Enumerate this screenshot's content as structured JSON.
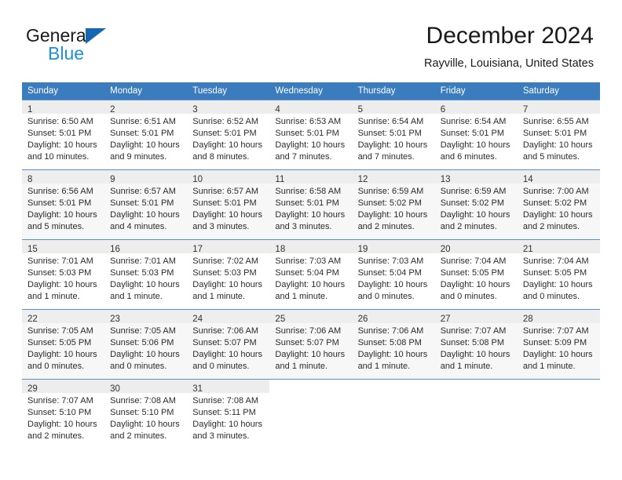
{
  "brand": {
    "word_one": "General",
    "word_two": "Blue",
    "logo_icon": "triangle-logo-icon",
    "accent_color": "#1567b2",
    "blue_text_color": "#1e8fdb"
  },
  "header": {
    "title": "December 2024",
    "location": "Rayville, Louisiana, United States"
  },
  "calendar": {
    "header_bg": "#3b7cbe",
    "header_text_color": "#ffffff",
    "weekdays": [
      "Sunday",
      "Monday",
      "Tuesday",
      "Wednesday",
      "Thursday",
      "Friday",
      "Saturday"
    ],
    "weeks": [
      [
        {
          "day": "1",
          "sunrise": "Sunrise: 6:50 AM",
          "sunset": "Sunset: 5:01 PM",
          "daylight_1": "Daylight: 10 hours",
          "daylight_2": "and 10 minutes."
        },
        {
          "day": "2",
          "sunrise": "Sunrise: 6:51 AM",
          "sunset": "Sunset: 5:01 PM",
          "daylight_1": "Daylight: 10 hours",
          "daylight_2": "and 9 minutes."
        },
        {
          "day": "3",
          "sunrise": "Sunrise: 6:52 AM",
          "sunset": "Sunset: 5:01 PM",
          "daylight_1": "Daylight: 10 hours",
          "daylight_2": "and 8 minutes."
        },
        {
          "day": "4",
          "sunrise": "Sunrise: 6:53 AM",
          "sunset": "Sunset: 5:01 PM",
          "daylight_1": "Daylight: 10 hours",
          "daylight_2": "and 7 minutes."
        },
        {
          "day": "5",
          "sunrise": "Sunrise: 6:54 AM",
          "sunset": "Sunset: 5:01 PM",
          "daylight_1": "Daylight: 10 hours",
          "daylight_2": "and 7 minutes."
        },
        {
          "day": "6",
          "sunrise": "Sunrise: 6:54 AM",
          "sunset": "Sunset: 5:01 PM",
          "daylight_1": "Daylight: 10 hours",
          "daylight_2": "and 6 minutes."
        },
        {
          "day": "7",
          "sunrise": "Sunrise: 6:55 AM",
          "sunset": "Sunset: 5:01 PM",
          "daylight_1": "Daylight: 10 hours",
          "daylight_2": "and 5 minutes."
        }
      ],
      [
        {
          "day": "8",
          "sunrise": "Sunrise: 6:56 AM",
          "sunset": "Sunset: 5:01 PM",
          "daylight_1": "Daylight: 10 hours",
          "daylight_2": "and 5 minutes."
        },
        {
          "day": "9",
          "sunrise": "Sunrise: 6:57 AM",
          "sunset": "Sunset: 5:01 PM",
          "daylight_1": "Daylight: 10 hours",
          "daylight_2": "and 4 minutes."
        },
        {
          "day": "10",
          "sunrise": "Sunrise: 6:57 AM",
          "sunset": "Sunset: 5:01 PM",
          "daylight_1": "Daylight: 10 hours",
          "daylight_2": "and 3 minutes."
        },
        {
          "day": "11",
          "sunrise": "Sunrise: 6:58 AM",
          "sunset": "Sunset: 5:01 PM",
          "daylight_1": "Daylight: 10 hours",
          "daylight_2": "and 3 minutes."
        },
        {
          "day": "12",
          "sunrise": "Sunrise: 6:59 AM",
          "sunset": "Sunset: 5:02 PM",
          "daylight_1": "Daylight: 10 hours",
          "daylight_2": "and 2 minutes."
        },
        {
          "day": "13",
          "sunrise": "Sunrise: 6:59 AM",
          "sunset": "Sunset: 5:02 PM",
          "daylight_1": "Daylight: 10 hours",
          "daylight_2": "and 2 minutes."
        },
        {
          "day": "14",
          "sunrise": "Sunrise: 7:00 AM",
          "sunset": "Sunset: 5:02 PM",
          "daylight_1": "Daylight: 10 hours",
          "daylight_2": "and 2 minutes."
        }
      ],
      [
        {
          "day": "15",
          "sunrise": "Sunrise: 7:01 AM",
          "sunset": "Sunset: 5:03 PM",
          "daylight_1": "Daylight: 10 hours",
          "daylight_2": "and 1 minute."
        },
        {
          "day": "16",
          "sunrise": "Sunrise: 7:01 AM",
          "sunset": "Sunset: 5:03 PM",
          "daylight_1": "Daylight: 10 hours",
          "daylight_2": "and 1 minute."
        },
        {
          "day": "17",
          "sunrise": "Sunrise: 7:02 AM",
          "sunset": "Sunset: 5:03 PM",
          "daylight_1": "Daylight: 10 hours",
          "daylight_2": "and 1 minute."
        },
        {
          "day": "18",
          "sunrise": "Sunrise: 7:03 AM",
          "sunset": "Sunset: 5:04 PM",
          "daylight_1": "Daylight: 10 hours",
          "daylight_2": "and 1 minute."
        },
        {
          "day": "19",
          "sunrise": "Sunrise: 7:03 AM",
          "sunset": "Sunset: 5:04 PM",
          "daylight_1": "Daylight: 10 hours",
          "daylight_2": "and 0 minutes."
        },
        {
          "day": "20",
          "sunrise": "Sunrise: 7:04 AM",
          "sunset": "Sunset: 5:05 PM",
          "daylight_1": "Daylight: 10 hours",
          "daylight_2": "and 0 minutes."
        },
        {
          "day": "21",
          "sunrise": "Sunrise: 7:04 AM",
          "sunset": "Sunset: 5:05 PM",
          "daylight_1": "Daylight: 10 hours",
          "daylight_2": "and 0 minutes."
        }
      ],
      [
        {
          "day": "22",
          "sunrise": "Sunrise: 7:05 AM",
          "sunset": "Sunset: 5:05 PM",
          "daylight_1": "Daylight: 10 hours",
          "daylight_2": "and 0 minutes."
        },
        {
          "day": "23",
          "sunrise": "Sunrise: 7:05 AM",
          "sunset": "Sunset: 5:06 PM",
          "daylight_1": "Daylight: 10 hours",
          "daylight_2": "and 0 minutes."
        },
        {
          "day": "24",
          "sunrise": "Sunrise: 7:06 AM",
          "sunset": "Sunset: 5:07 PM",
          "daylight_1": "Daylight: 10 hours",
          "daylight_2": "and 0 minutes."
        },
        {
          "day": "25",
          "sunrise": "Sunrise: 7:06 AM",
          "sunset": "Sunset: 5:07 PM",
          "daylight_1": "Daylight: 10 hours",
          "daylight_2": "and 1 minute."
        },
        {
          "day": "26",
          "sunrise": "Sunrise: 7:06 AM",
          "sunset": "Sunset: 5:08 PM",
          "daylight_1": "Daylight: 10 hours",
          "daylight_2": "and 1 minute."
        },
        {
          "day": "27",
          "sunrise": "Sunrise: 7:07 AM",
          "sunset": "Sunset: 5:08 PM",
          "daylight_1": "Daylight: 10 hours",
          "daylight_2": "and 1 minute."
        },
        {
          "day": "28",
          "sunrise": "Sunrise: 7:07 AM",
          "sunset": "Sunset: 5:09 PM",
          "daylight_1": "Daylight: 10 hours",
          "daylight_2": "and 1 minute."
        }
      ],
      [
        {
          "day": "29",
          "sunrise": "Sunrise: 7:07 AM",
          "sunset": "Sunset: 5:10 PM",
          "daylight_1": "Daylight: 10 hours",
          "daylight_2": "and 2 minutes."
        },
        {
          "day": "30",
          "sunrise": "Sunrise: 7:08 AM",
          "sunset": "Sunset: 5:10 PM",
          "daylight_1": "Daylight: 10 hours",
          "daylight_2": "and 2 minutes."
        },
        {
          "day": "31",
          "sunrise": "Sunrise: 7:08 AM",
          "sunset": "Sunset: 5:11 PM",
          "daylight_1": "Daylight: 10 hours",
          "daylight_2": "and 3 minutes."
        },
        null,
        null,
        null,
        null
      ]
    ]
  }
}
